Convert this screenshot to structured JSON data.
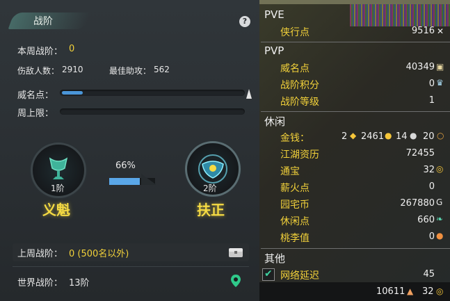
{
  "left": {
    "title": "战阶",
    "help": "?",
    "weekly_label": "本周战阶：",
    "weekly_value": "0",
    "injured_label": "伤敌人数：",
    "injured_value": "2910",
    "assist_label": "最佳助攻：",
    "assist_value": "562",
    "fame_label": "威名点：",
    "fame_fill": 0.06,
    "weekly_cap_label": "周上限：",
    "weekly_cap_fill": 0,
    "rank_current": {
      "level": "1阶",
      "name": "义魁"
    },
    "rank_next": {
      "level": "2阶",
      "name": "扶正"
    },
    "progress_pct": "66%",
    "progress_value": 0.66,
    "last_week_label": "上周战阶：",
    "last_week_value": "0 (500名以外)",
    "world_label": "世界战阶：",
    "world_value": "13阶"
  },
  "right": {
    "section_pve": "PVE",
    "section_pvp": "PVP",
    "section_leisure": "休闲",
    "section_other": "其他",
    "rows_pve": [
      {
        "label": "侠行点",
        "value": "9516"
      }
    ],
    "rows_pvp": [
      {
        "label": "威名点",
        "value": "40349"
      },
      {
        "label": "战阶积分",
        "value": "0"
      },
      {
        "label": "战阶等级",
        "value": "1"
      }
    ],
    "money_label": "金钱：",
    "money_values": [
      "2",
      "2461",
      "14",
      "20"
    ],
    "rows_leisure": [
      {
        "label": "江湖资历",
        "value": "72455"
      },
      {
        "label": "通宝",
        "value": "32"
      },
      {
        "label": "薪火点",
        "value": "0"
      },
      {
        "label": "园宅币",
        "value": "267880"
      },
      {
        "label": "休闲点",
        "value": "660"
      },
      {
        "label": "桃李值",
        "value": "0"
      }
    ],
    "latency_label": "网络延迟",
    "latency_value": "45",
    "bottom_value_1": "10611",
    "bottom_value_2": "32"
  }
}
